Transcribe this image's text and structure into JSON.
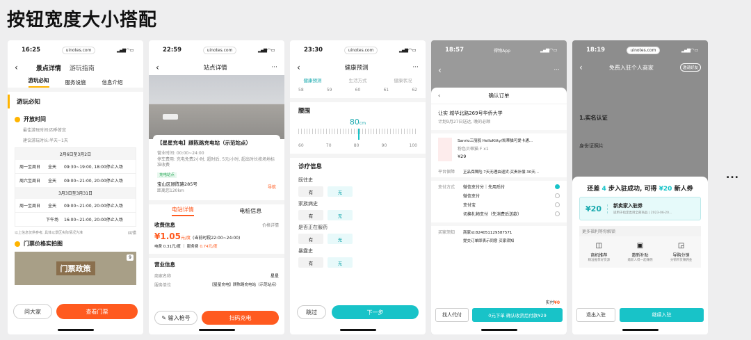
{
  "page_title": "按钮宽度大小搭配",
  "more": "...",
  "p1": {
    "time": "16:25",
    "url": "uinotes.com",
    "tab_detail": "景点详情",
    "tab_guide": "游玩指南",
    "sub_tabs": [
      "游玩必知",
      "服务设施",
      "信息介绍"
    ],
    "section_title": "游玩必知",
    "open_time": "开放时间",
    "best_season": "最佳游玩时间:四季皆宜",
    "suggested": "建议游玩时长:半天~1天",
    "range1": "2月6日至3月2日",
    "range2": "3月3日至3月31日",
    "rows1": [
      {
        "d": "周一至周日",
        "t": "全天",
        "h": "09:30~19:00, 18:00停止入场"
      },
      {
        "d": "周六至周日",
        "t": "全天",
        "h": "09:00~21:00, 20:00停止入场"
      }
    ],
    "rows2": [
      {
        "d": "周一至周日",
        "t": "全天",
        "h": "09:00~21:00, 20:00停止入场"
      },
      {
        "d": "",
        "t": "下午场",
        "h": "16:00~21:00, 20:00停止入场"
      }
    ],
    "note": "以上信息仅供参考, 具体以景区实际情况为准",
    "edit": "纠错",
    "pic_title": "门票价格实拍图",
    "pic_text": "门票政策",
    "pic_count": "9",
    "ask": "问大家",
    "ticket": "查看门票"
  },
  "p2": {
    "time": "22:59",
    "url": "uinotes.com",
    "title": "站点详情",
    "station": "【星星充电】顾陈路充电站（示范站点）",
    "open": "营业时间: 00:00~24:00",
    "parking": "停车费用: 充电免费2小时, 超时后, 5元/小时, 超出时长按场地标准收费",
    "tag": "充电站点",
    "address": "宝山区顾陈路285号",
    "distance": "距离您120km",
    "nav": "导航",
    "tab1": "电站详情",
    "tab2": "电桩信息",
    "fee_title": "收费信息",
    "price_link": "价格详情",
    "price": "¥1.05",
    "price_unit": "元/度",
    "price_note": "(当前时段22:00~24:00)",
    "fee_detail": "电费 0.31元/度 ｜ 服务费",
    "service_fee": "0.74元/度",
    "biz_title": "营业信息",
    "merchant_k": "商家名称",
    "merchant_v": "星星",
    "service_k": "服务单位",
    "service_v": "【星星充电】顾陈路充电站（示范站点）",
    "input_btn": "输入枪号",
    "scan_btn": "扫码充电"
  },
  "p3": {
    "time": "23:30",
    "url": "uinotes.com",
    "title": "健康预测",
    "steps": [
      "健康预测",
      "生活方式",
      "健康状况"
    ],
    "top_ticks": [
      "58",
      "59",
      "60",
      "61",
      "62"
    ],
    "waist": "腰围",
    "waist_val": "80",
    "waist_unit": "cm",
    "ticks": [
      "60",
      "70",
      "80",
      "90",
      "100"
    ],
    "diag": "诊疗信息",
    "questions": [
      "既往史",
      "家族病史",
      "是否正在服药",
      "暴露史"
    ],
    "yes": "有",
    "no": "无",
    "skip": "跳过",
    "next": "下一步"
  },
  "p4": {
    "time": "18:57",
    "app": "得物App",
    "sheet_title": "确认订单",
    "addr": "让实 城华北路269号华侨大学",
    "addr_sub": "计划9月27日送达, 晚的必顺",
    "product": "Sanrio三丽鸥 HelloKitty/凯蒂猫可爱卡通...",
    "spec": "粉色贝蒂猫 F  x1",
    "price": "¥29",
    "guarantee_k": "平台保障",
    "guarantee_v": "正品保障险·7天无理由退货·买贵补偿·30天...",
    "pay_k": "支付方式",
    "pays": [
      "微信支付分｜先用后付",
      "微信支付",
      "支付宝"
    ],
    "pay_extra": "切换礼物支付（先消费后送款）",
    "order_k": "买家须知",
    "order_v1": "商家id:824051129587571",
    "order_v2": "提交订单即表示同意  买家须知",
    "real": "实付",
    "real_v": "¥0",
    "friend": "找人代付",
    "confirm": "0元下单 确认收货后付款¥29"
  },
  "p5": {
    "time": "18:19",
    "url": "uinotes.com",
    "title": "免费入驻个人商家",
    "share": "邀请好友",
    "cert": "1.实名认证",
    "id_photo": "身份证照片",
    "promo": "还差",
    "promo_n": "4",
    "promo_mid": "步入驻成功, 可得",
    "promo_amt": "¥20",
    "promo_end": "新人券",
    "coupon_amt": "¥20",
    "coupon_title": "新卖家入驻券",
    "coupon_sub": "适用于指定类目全部商品 | 2023-06-20...",
    "benefit_tip": "更多福利等你解锁",
    "benefits": [
      "商机推荐",
      "邀新补贴",
      "导购分销"
    ],
    "benefit_subs": [
      "精准推荐好货源",
      "邀新人得一起赚佣",
      "分销带货赚佣金"
    ],
    "exit": "退出入驻",
    "go": "继续入驻"
  }
}
